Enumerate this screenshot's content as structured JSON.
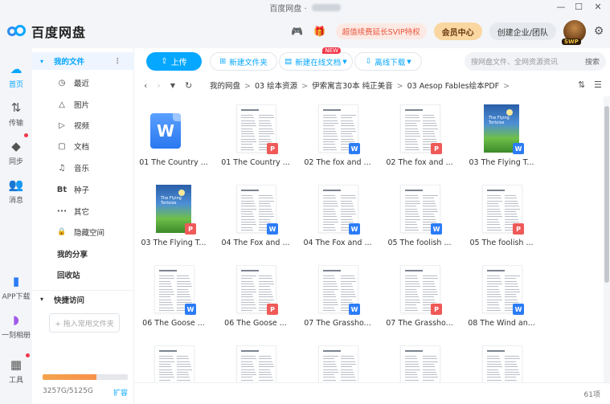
{
  "titlebar": {
    "title": "百度网盘 ·",
    "minimize": "—",
    "maximize": "☐",
    "close": "✕"
  },
  "header": {
    "logo_text": "百度网盘",
    "game_icon": "🎮",
    "gift_icon": "🎁",
    "vip_promo": "超值续费延长SVIP特权",
    "member_center": "会员中心",
    "enterprise": "创建企业/团队",
    "avatar_badge": "SWP",
    "settings_icon": "⚙"
  },
  "rail": {
    "items": [
      {
        "label": "首页",
        "icon": "☁",
        "active": true
      },
      {
        "label": "传输",
        "icon": "⇅",
        "active": false
      },
      {
        "label": "同步",
        "icon": "◆",
        "active": false
      },
      {
        "label": "消息",
        "icon": "👥",
        "active": false
      },
      {
        "label": "APP下载",
        "icon": "▮",
        "active": false
      },
      {
        "label": "一刻相册",
        "icon": "◗",
        "active": false
      },
      {
        "label": "工具",
        "icon": "▦",
        "active": false
      }
    ]
  },
  "nav": {
    "my_files": "我的文件",
    "items": [
      {
        "label": "最近",
        "icon": "◷"
      },
      {
        "label": "图片",
        "icon": "△"
      },
      {
        "label": "视频",
        "icon": "▷"
      },
      {
        "label": "文档",
        "icon": "▢"
      },
      {
        "label": "音乐",
        "icon": "♫"
      },
      {
        "label": "种子",
        "icon": "Bt"
      },
      {
        "label": "其它",
        "icon": "•••"
      },
      {
        "label": "隐藏空间",
        "icon": "🔒"
      }
    ],
    "my_share": "我的分享",
    "recycle": "回收站",
    "quick_access": "快捷访问",
    "add_folder": "+ 拖入常用文件夹",
    "storage_text": "3257G/5125G",
    "storage_fraction": 0.636,
    "expand": "扩容"
  },
  "toolbar": {
    "upload": "上传",
    "new_folder": "新建文件夹",
    "new_doc": "新建在线文档",
    "new_badge": "NEW",
    "offline": "离线下载",
    "search_placeholder": "搜网盘文件、全网资源资讯",
    "search_button": "搜索"
  },
  "breadcrumb": {
    "crumbs": [
      "我的网盘",
      "03 绘本资源",
      "伊索寓言30本 纯正美音",
      "03 Aesop Fables绘本PDF"
    ]
  },
  "files": [
    {
      "name": "01 The Country ...",
      "kind": "word-big",
      "tag": "W"
    },
    {
      "name": "01 The Country ...",
      "kind": "doc",
      "tag": "P"
    },
    {
      "name": "02 The fox and ...",
      "kind": "doc",
      "tag": "W"
    },
    {
      "name": "02 The fox and ...",
      "kind": "doc",
      "tag": "P"
    },
    {
      "name": "03 The Flying T...",
      "kind": "book",
      "tag": "W",
      "cover_title": "The Flying Tortoise"
    },
    {
      "name": "03 The Flying T...",
      "kind": "book",
      "tag": "P",
      "cover_title": "The Flying Tortoise"
    },
    {
      "name": "04 The Fox and ...",
      "kind": "doc",
      "tag": "W"
    },
    {
      "name": "04 The Fox and ...",
      "kind": "doc",
      "tag": "W"
    },
    {
      "name": "05 The foolish ...",
      "kind": "doc",
      "tag": "W"
    },
    {
      "name": "05 The foolish ...",
      "kind": "doc",
      "tag": "P"
    },
    {
      "name": "06 The Goose ...",
      "kind": "doc",
      "tag": "W"
    },
    {
      "name": "06 The Goose ...",
      "kind": "doc",
      "tag": "P"
    },
    {
      "name": "07 The Grassho...",
      "kind": "doc",
      "tag": "W"
    },
    {
      "name": "07 The Grassho...",
      "kind": "doc",
      "tag": "P"
    },
    {
      "name": "08 The Wind an...",
      "kind": "doc",
      "tag": "W"
    },
    {
      "name": "",
      "kind": "doc",
      "tag": ""
    },
    {
      "name": "",
      "kind": "doc",
      "tag": ""
    },
    {
      "name": "",
      "kind": "doc",
      "tag": ""
    },
    {
      "name": "",
      "kind": "doc",
      "tag": ""
    },
    {
      "name": "",
      "kind": "doc",
      "tag": ""
    }
  ],
  "footer": {
    "count": "61项"
  }
}
